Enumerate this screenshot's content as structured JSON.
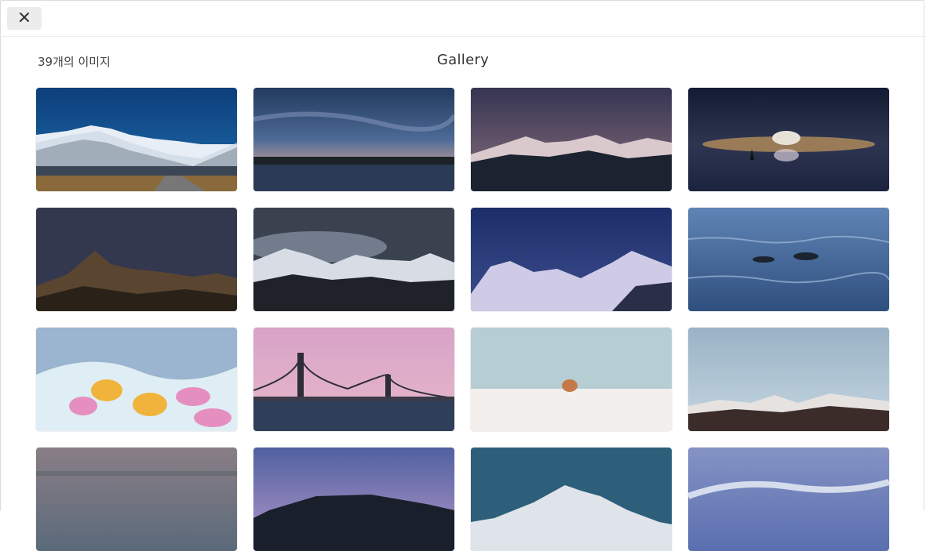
{
  "toolbar": {
    "close_icon": "close-icon"
  },
  "header": {
    "count_label": "39개의 이미지",
    "title": "Gallery"
  },
  "gallery": {
    "images": [
      {
        "scene": "snowy-mountain-road"
      },
      {
        "scene": "dusk-lake-horizon"
      },
      {
        "scene": "mountain-range-dusk"
      },
      {
        "scene": "night-sea-sailboat"
      },
      {
        "scene": "mountain-starry-night"
      },
      {
        "scene": "cloudy-snow-mountains"
      },
      {
        "scene": "blue-snow-peaks"
      },
      {
        "scene": "dolphins-sea"
      },
      {
        "scene": "rubber-ducks-bath"
      },
      {
        "scene": "bay-bridge-sunset"
      },
      {
        "scene": "cat-in-snow"
      },
      {
        "scene": "snow-mountains-pastel-sky"
      },
      {
        "scene": "hazy-sea"
      },
      {
        "scene": "island-palms-dusk"
      },
      {
        "scene": "rocky-snow-peak"
      },
      {
        "scene": "clouds-blue-sky"
      }
    ]
  }
}
